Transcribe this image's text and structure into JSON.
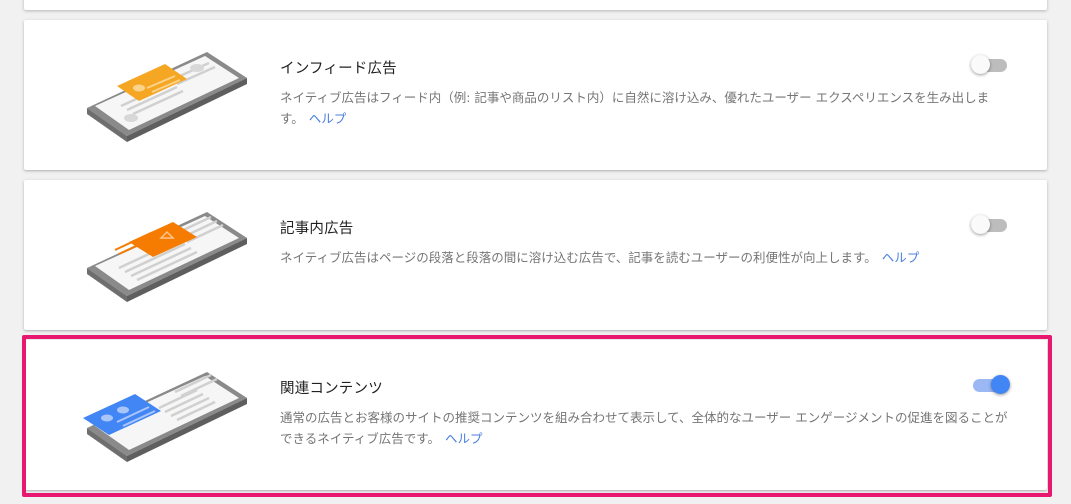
{
  "colors": {
    "accent_blue": "#4285f4",
    "link_blue": "#4a7ee0",
    "highlight_pink": "#e8176f",
    "infeed_orange": "#f5a623",
    "in_article_orange": "#f57c00"
  },
  "cards": [
    {
      "title": "インフィード広告",
      "desc": "ネイティブ広告はフィード内（例: 記事や商品のリスト内）に自然に溶け込み、優れたユーザー エクスペリエンスを生み出します。",
      "help": "ヘルプ",
      "toggle": "off",
      "icon": "phone-infeed-illustration"
    },
    {
      "title": "記事内広告",
      "desc": "ネイティブ広告はページの段落と段落の間に溶け込む広告で、記事を読むユーザーの利便性が向上します。",
      "help": "ヘルプ",
      "toggle": "off",
      "icon": "phone-in-article-illustration"
    },
    {
      "title": "関連コンテンツ",
      "desc": "通常の広告とお客様のサイトの推奨コンテンツを組み合わせて表示して、全体的なユーザー エンゲージメントの促進を図ることができるネイティブ広告です。",
      "help": "ヘルプ",
      "toggle": "on",
      "icon": "phone-related-content-illustration"
    }
  ]
}
